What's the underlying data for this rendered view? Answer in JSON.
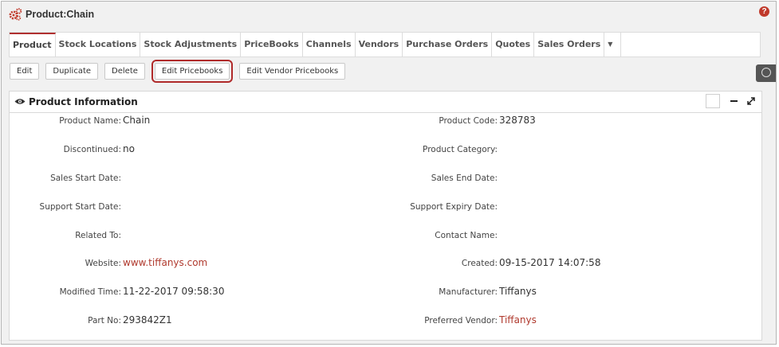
{
  "header": {
    "title": "Product:Chain",
    "help_label": "?"
  },
  "tabs": [
    {
      "label": "Product",
      "active": true
    },
    {
      "label": "Stock Locations"
    },
    {
      "label": "Stock Adjustments"
    },
    {
      "label": "PriceBooks"
    },
    {
      "label": "Channels"
    },
    {
      "label": "Vendors"
    },
    {
      "label": "Purchase Orders"
    },
    {
      "label": "Quotes"
    },
    {
      "label": "Sales Orders"
    }
  ],
  "tabs_more": "▼",
  "actions": {
    "edit": "Edit",
    "duplicate": "Duplicate",
    "delete": "Delete",
    "edit_pricebooks": "Edit Pricebooks",
    "edit_vendor_pricebooks": "Edit Vendor Pricebooks"
  },
  "panel": {
    "title": "Product Information",
    "fields": [
      {
        "left_label": "Product Name:",
        "left_value": "Chain",
        "right_label": "Product Code:",
        "right_value": "328783"
      },
      {
        "left_label": "Discontinued:",
        "left_value": "no",
        "right_label": "Product Category:",
        "right_value": ""
      },
      {
        "left_label": "Sales Start Date:",
        "left_value": "",
        "right_label": "Sales End Date:",
        "right_value": ""
      },
      {
        "left_label": "Support Start Date:",
        "left_value": "",
        "right_label": "Support Expiry Date:",
        "right_value": ""
      },
      {
        "left_label": "Related To:",
        "left_value": "",
        "right_label": "Contact Name:",
        "right_value": ""
      },
      {
        "left_label": "Website:",
        "left_value": "www.tiffanys.com",
        "right_label": "Created:",
        "right_value": "09-15-2017 14:07:58"
      },
      {
        "left_label": "Modified Time:",
        "left_value": "11-22-2017 09:58:30",
        "right_label": "Manufacturer:",
        "right_value": "Tiffanys"
      },
      {
        "left_label": "Part No:",
        "left_value": "293842Z1",
        "right_label": "Preferred Vendor:",
        "right_value": "Tiffanys"
      }
    ]
  },
  "colors": {
    "accent": "#b03030",
    "link": "#b03a2e"
  },
  "icons": [
    "gears-icon",
    "help-icon",
    "eye-icon",
    "minimize-icon",
    "expand-icon",
    "clock-icon"
  ]
}
